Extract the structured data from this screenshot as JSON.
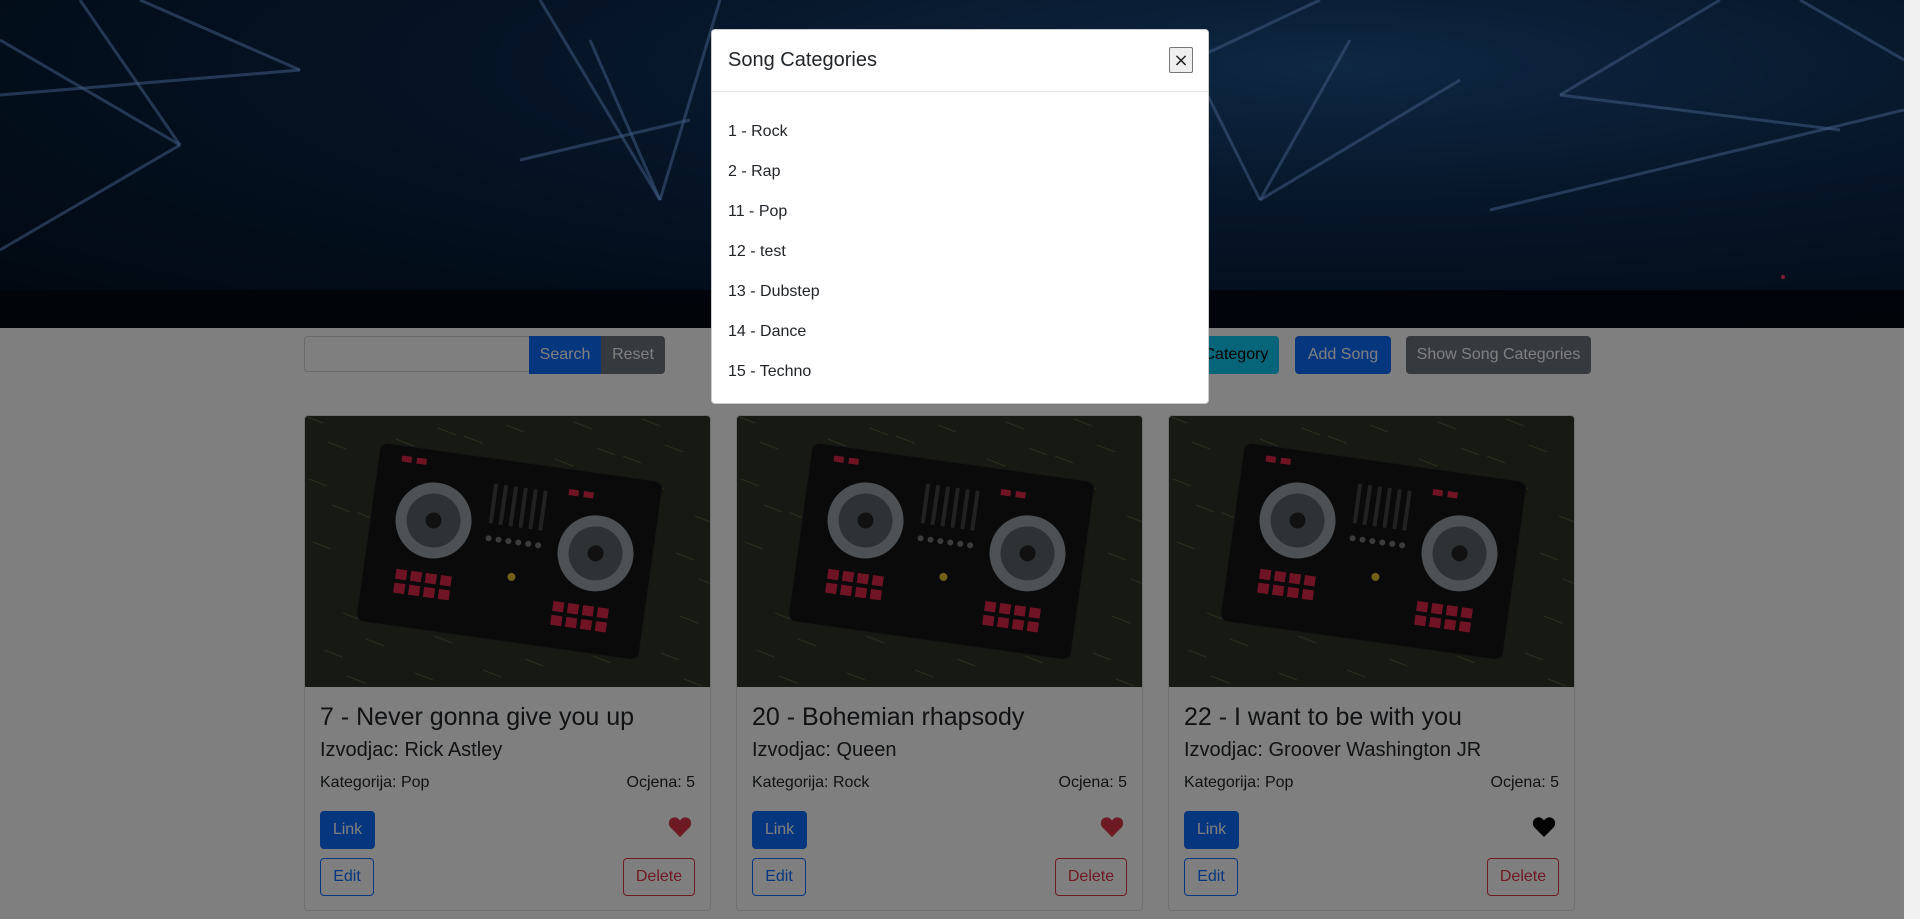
{
  "toolbar": {
    "search_placeholder": "",
    "search_label": "Search",
    "reset_label": "Reset",
    "add_category_label": "Add Category",
    "add_song_label": "Add Song",
    "show_categories_label": "Show Song Categories"
  },
  "songs": [
    {
      "title": "7 - Never gonna give you up",
      "artist": "Izvodjac: Rick Astley",
      "category": "Kategorija: Pop",
      "rating": "Ocjena: 5",
      "favorite": true,
      "link_label": "Link",
      "edit_label": "Edit",
      "delete_label": "Delete"
    },
    {
      "title": "20 - Bohemian rhapsody",
      "artist": "Izvodjac: Queen",
      "category": "Kategorija: Rock",
      "rating": "Ocjena: 5",
      "favorite": true,
      "link_label": "Link",
      "edit_label": "Edit",
      "delete_label": "Delete"
    },
    {
      "title": "22 - I want to be with you",
      "artist": "Izvodjac: Groover Washington JR",
      "category": "Kategorija: Pop",
      "rating": "Ocjena: 5",
      "favorite": false,
      "link_label": "Link",
      "edit_label": "Edit",
      "delete_label": "Delete"
    }
  ],
  "modal": {
    "title": "Song Categories",
    "close_symbol": "×",
    "categories": [
      "1 - Rock",
      "2 - Rap",
      "11 - Pop",
      "12 - test",
      "13 - Dubstep",
      "14 - Dance",
      "15 - Techno"
    ]
  },
  "colors": {
    "primary": "#0d6efd",
    "secondary": "#6c757d",
    "info": "#0dcaf0",
    "danger": "#dc3545",
    "favorite_heart": "#dc3545",
    "not_favorite_heart": "#000000"
  },
  "icons": {
    "favorite": "heart-icon",
    "close": "close-icon"
  }
}
